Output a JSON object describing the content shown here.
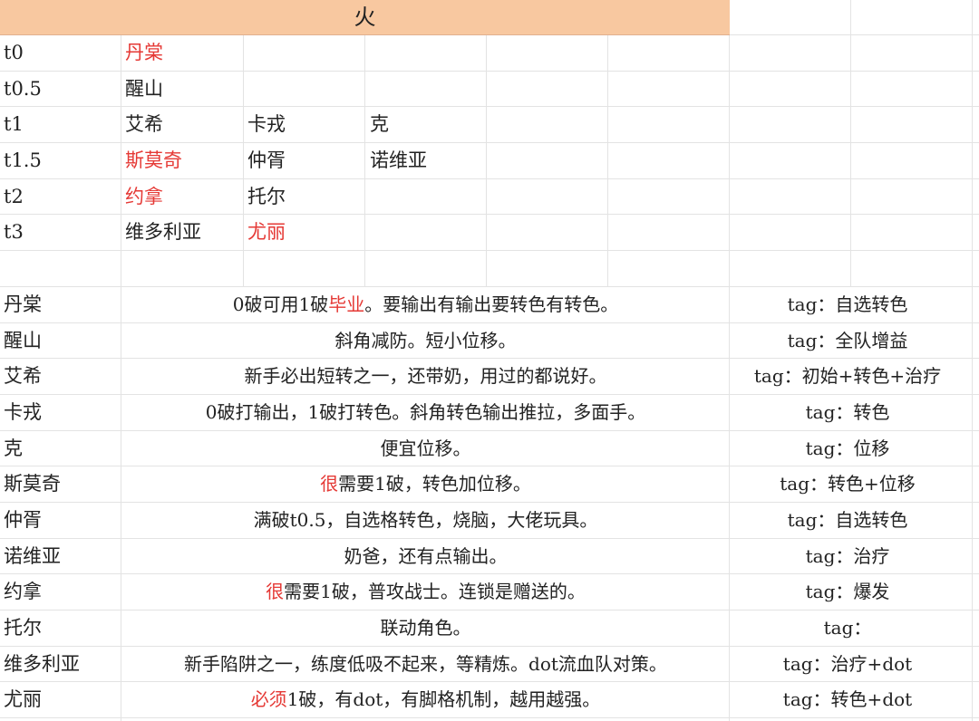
{
  "header": {
    "element": "火"
  },
  "tiers": [
    {
      "label": "t0",
      "chars": [
        {
          "name": "丹棠",
          "red": true
        }
      ]
    },
    {
      "label": "t0.5",
      "chars": [
        {
          "name": "醒山",
          "red": false
        }
      ]
    },
    {
      "label": "t1",
      "chars": [
        {
          "name": "艾希",
          "red": false
        },
        {
          "name": "卡戎",
          "red": false
        },
        {
          "name": "克",
          "red": false
        }
      ]
    },
    {
      "label": "t1.5",
      "chars": [
        {
          "name": "斯莫奇",
          "red": true
        },
        {
          "name": "仲胥",
          "red": false
        },
        {
          "name": "诺维亚",
          "red": false
        }
      ]
    },
    {
      "label": "t2",
      "chars": [
        {
          "name": "约拿",
          "red": true
        },
        {
          "name": "托尔",
          "red": false
        }
      ]
    },
    {
      "label": "t3",
      "chars": [
        {
          "name": "维多利亚",
          "red": false
        },
        {
          "name": "尤丽",
          "red": true
        }
      ]
    }
  ],
  "details": [
    {
      "name": "丹棠",
      "desc_pre": "0破可用1破",
      "desc_red": "毕业",
      "desc_post": "。要输出有输出要转色有转色。",
      "tag": "tag：自选转色"
    },
    {
      "name": "醒山",
      "desc_pre": "斜角减防。短小位移。",
      "desc_red": "",
      "desc_post": "",
      "tag": "tag：全队增益"
    },
    {
      "name": "艾希",
      "desc_pre": "新手必出短转之一，还带奶，用过的都说好。",
      "desc_red": "",
      "desc_post": "",
      "tag": "tag：初始+转色+治疗"
    },
    {
      "name": "卡戎",
      "desc_pre": "0破打输出，1破打转色。斜角转色输出推拉，多面手。",
      "desc_red": "",
      "desc_post": "",
      "tag": "tag：转色"
    },
    {
      "name": "克",
      "desc_pre": "便宜位移。",
      "desc_red": "",
      "desc_post": "",
      "tag": "tag：位移"
    },
    {
      "name": "斯莫奇",
      "desc_pre": "",
      "desc_red": "很",
      "desc_post": "需要1破，转色加位移。",
      "tag": "tag：转色+位移"
    },
    {
      "name": "仲胥",
      "desc_pre": "满破t0.5，自选格转色，烧脑，大佬玩具。",
      "desc_red": "",
      "desc_post": "",
      "tag": "tag：自选转色"
    },
    {
      "name": "诺维亚",
      "desc_pre": "奶爸，还有点输出。",
      "desc_red": "",
      "desc_post": "",
      "tag": "tag：治疗"
    },
    {
      "name": "约拿",
      "desc_pre": "",
      "desc_red": "很",
      "desc_post": "需要1破，普攻战士。连锁是赠送的。",
      "tag": "tag：爆发"
    },
    {
      "name": "托尔",
      "desc_pre": "联动角色。",
      "desc_red": "",
      "desc_post": "",
      "tag": "tag："
    },
    {
      "name": "维多利亚",
      "desc_pre": "新手陷阱之一，练度低吸不起来，等精炼。dot流血队对策。",
      "desc_red": "",
      "desc_post": "",
      "tag": "tag：治疗+dot"
    },
    {
      "name": "尤丽",
      "desc_pre": "",
      "desc_red": "必须",
      "desc_post": "1破，有dot，有脚格机制，越用越强。",
      "tag": "tag：转色+dot"
    }
  ]
}
